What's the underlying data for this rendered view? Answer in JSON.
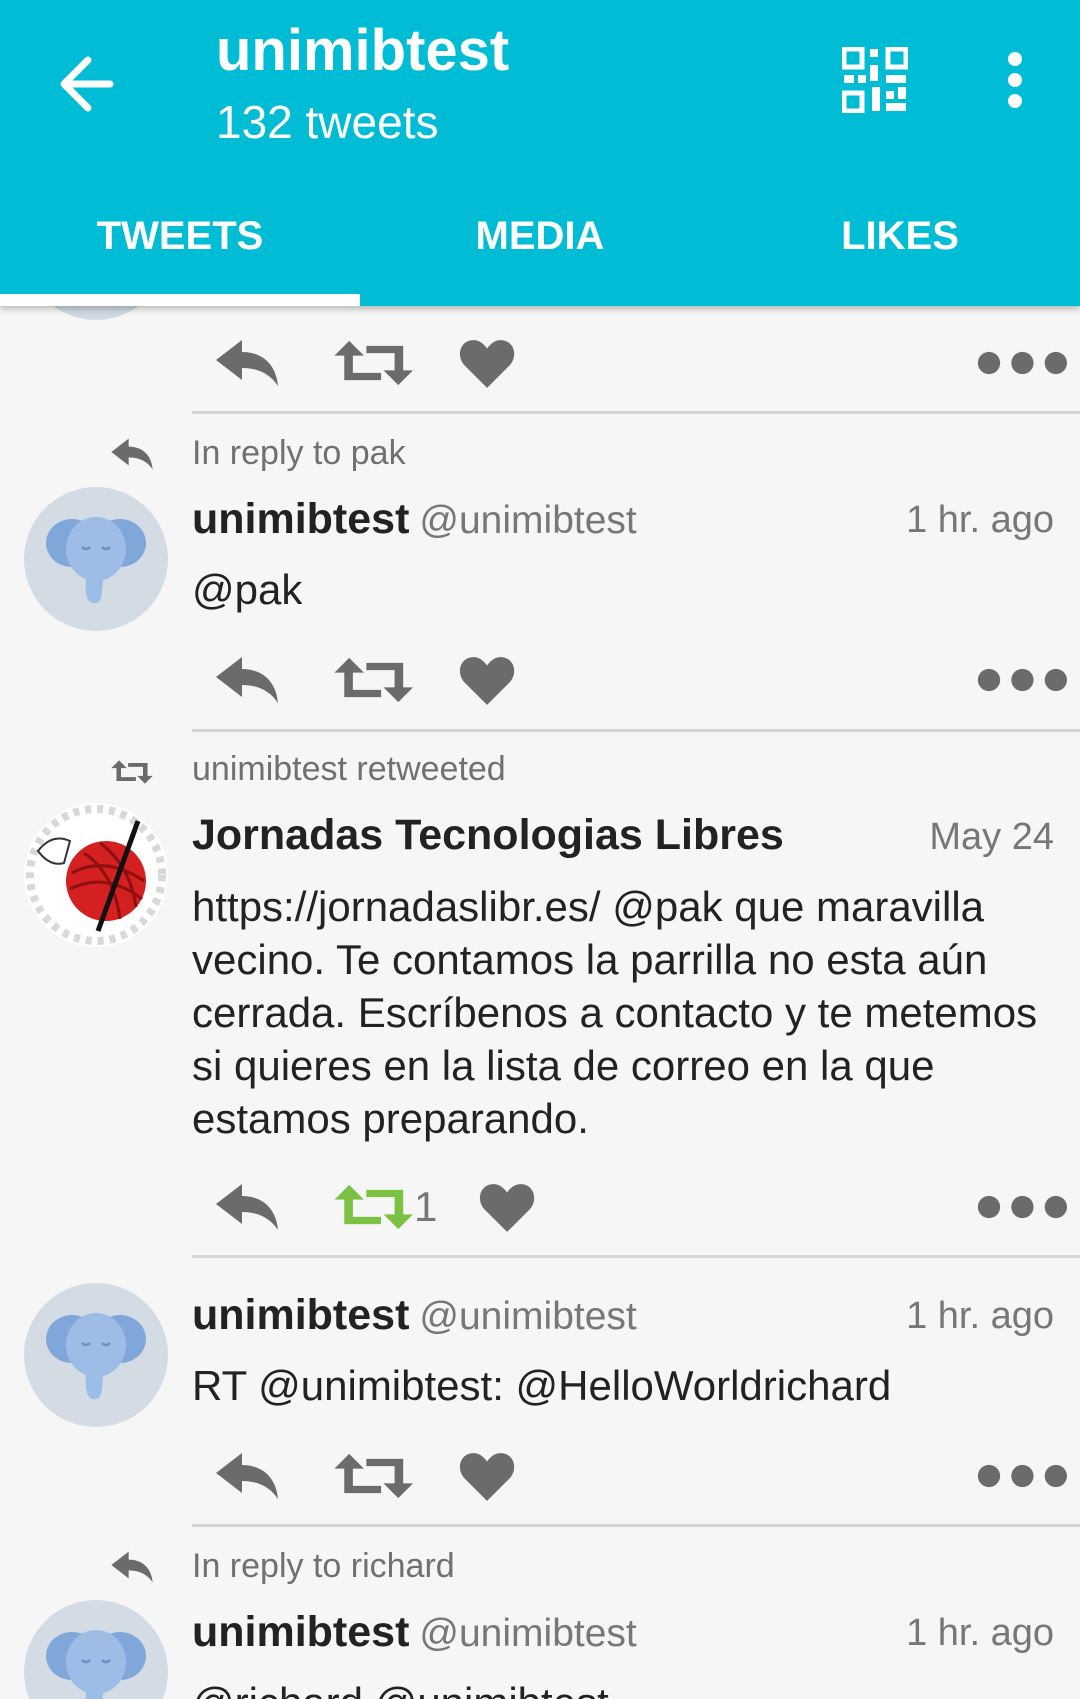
{
  "header": {
    "title": "unimibtest",
    "subtitle": "132 tweets",
    "accent_color": "#00bcd4",
    "back_icon": "arrow-left-icon",
    "qr_icon": "qr-code-icon",
    "overflow_icon": "more-vertical-icon"
  },
  "tabs": [
    {
      "label": "TWEETS",
      "active": true
    },
    {
      "label": "MEDIA",
      "active": false
    },
    {
      "label": "LIKES",
      "active": false
    }
  ],
  "feed": {
    "tweets": [
      {
        "context": "In reply to pak",
        "context_icon": "reply-icon",
        "name": "unimibtest",
        "handle": "@unimibtest",
        "time": "1 hr. ago",
        "text": "@pak",
        "avatar": "elephant-avatar"
      },
      {
        "context": "unimibtest retweeted",
        "context_icon": "retweet-icon",
        "name": "Jornadas Tecnologias Libres",
        "handle": "",
        "time": "May 24",
        "text": "https://jornadaslibr.es/ @pak que maravilla vecino. Te contamos la parrilla no esta aún cerrada. Escríbenos a contacto y te metemos si quieres en la lista de correo en la que estamos preparando.",
        "avatar": "yarn-ball-avatar",
        "retweet_count": "1",
        "retweeted": true,
        "retweet_color": "#7cc242"
      },
      {
        "name": "unimibtest",
        "handle": "@unimibtest",
        "time": "1 hr. ago",
        "text": "RT @unimibtest: @HelloWorldrichard",
        "avatar": "elephant-avatar"
      },
      {
        "context": "In reply to richard",
        "context_icon": "reply-icon",
        "name": "unimibtest",
        "handle": "@unimibtest",
        "time": "1 hr. ago",
        "text": "@richard @unimibtest",
        "avatar": "elephant-avatar"
      }
    ]
  }
}
